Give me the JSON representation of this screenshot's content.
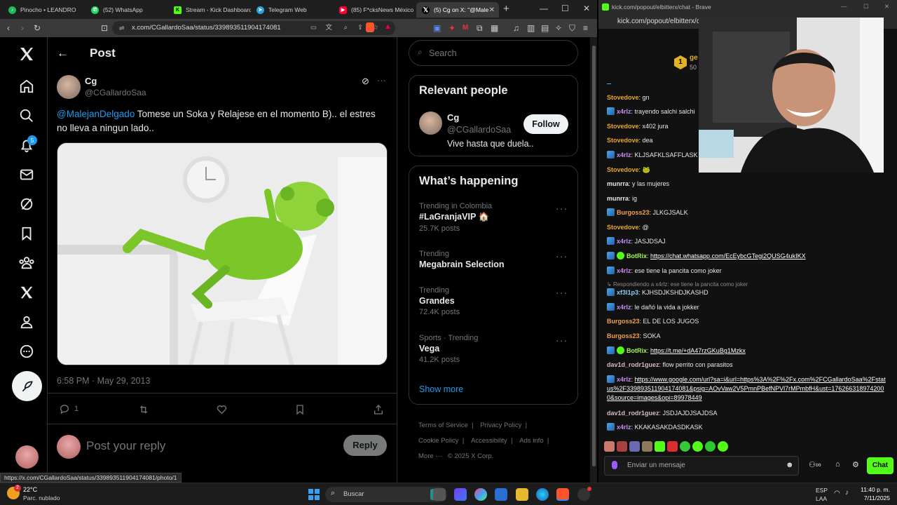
{
  "left_browser": {
    "tabs": [
      {
        "label": "Pinocho • LEANDRO",
        "color": "#1db954"
      },
      {
        "label": "(52) WhatsApp",
        "color": "#25d366"
      },
      {
        "label": "Stream - Kick Dashboard",
        "color": "#53fc18"
      },
      {
        "label": "Telegram Web",
        "color": "#2aa3e0"
      },
      {
        "label": "(85) F*cksNews México",
        "color": "#ff0033"
      },
      {
        "label": "(5) Cg on X: \"@Male",
        "color": "#ffffff"
      }
    ],
    "new_tab": "+",
    "window_controls": {
      "minimize": "—",
      "maximize": "☐",
      "close": "✕"
    },
    "url": "x.com/CGallardoSaa/status/339893511904174081",
    "status_bar_url": "https://x.com/CGallardoSaa/status/339893511904174081/photo/1"
  },
  "x": {
    "header_title": "Post",
    "notifications_badge": "5",
    "tweet": {
      "display_name": "Cg",
      "handle": "@CGallardoSaa",
      "mention": "@MalejanDelgado",
      "text": " Tomese un Soka y Relajese en el momento B).. el estres no lleva a ningun lado..",
      "timestamp": "6:58 PM · May 29, 2013",
      "reply_count": "1"
    },
    "reply_placeholder": "Post your reply",
    "reply_button": "Reply",
    "search_placeholder": "Search",
    "relevant_people": {
      "title": "Relevant people",
      "name": "Cg",
      "handle": "@CGallardoSaa",
      "bio": "Vive hasta que duela..",
      "follow_label": "Follow"
    },
    "whats_happening": {
      "title": "What’s happening",
      "trends": [
        {
          "meta": "Trending in Colombia",
          "name": "#LaGranjaVIP 🏠",
          "posts": "25.7K posts"
        },
        {
          "meta": "Trending",
          "name": "Megabrain Selection",
          "posts": ""
        },
        {
          "meta": "Trending",
          "name": "Grandes",
          "posts": "72.4K posts"
        },
        {
          "meta": "Sports · Trending",
          "name": "Vega",
          "posts": "41.2K posts"
        }
      ],
      "show_more": "Show more"
    },
    "footer": {
      "terms": "Terms of Service",
      "privacy": "Privacy Policy",
      "cookie": "Cookie Policy",
      "accessibility": "Accessibility",
      "ads": "Ads info",
      "more": "More ···",
      "copyright": "© 2025 X Corp."
    }
  },
  "right_browser": {
    "title": "kick.com/popout/elbitterx/chat - Brave",
    "url": "kick.com/popout/elbitterx/c",
    "chat_header_rank": "1",
    "chat_header_name": "ge",
    "chat_header_count": "50",
    "messages": [
      {
        "user": "Stovedove",
        "color": "#e6a82a",
        "badge": "",
        "text": "gn"
      },
      {
        "user": "x4rlz",
        "color": "#c58cf0",
        "badge": "blue",
        "text": "trayendo salchi salchi"
      },
      {
        "user": "Stovedove",
        "color": "#e6a82a",
        "badge": "",
        "text": "x402 jura"
      },
      {
        "user": "Stovedove",
        "color": "#e6a82a",
        "badge": "",
        "text": "dea"
      },
      {
        "user": "x4rlz",
        "color": "#c58cf0",
        "badge": "blue",
        "text": "KLJSAFKLSAFFLASK"
      },
      {
        "user": "Stovedove",
        "color": "#e6a82a",
        "badge": "",
        "text": "🐸"
      },
      {
        "user": "munrra",
        "color": "#e8e8e8",
        "badge": "",
        "text": "y las mujeres"
      },
      {
        "user": "munrra",
        "color": "#e8e8e8",
        "badge": "",
        "text": "ig"
      },
      {
        "user": "Burgoss23",
        "color": "#f0a050",
        "badge": "blue",
        "text": "JLKGJSALK"
      },
      {
        "user": "Stovedove",
        "color": "#e6a82a",
        "badge": "",
        "text": "@"
      },
      {
        "user": "x4rlz",
        "color": "#c58cf0",
        "badge": "blue",
        "text": "JASJDSAJ"
      },
      {
        "user": "BotRix",
        "color": "#a4f54c",
        "badge": "bot",
        "text": "https://chat.whatsapp.com/EcEybcGTegi2QUSG4ukIKX",
        "link": true
      },
      {
        "user": "x4rlz",
        "color": "#c58cf0",
        "badge": "blue",
        "text": "ese tiene la pancita como joker"
      },
      {
        "user": "xf3l1p3",
        "color": "#8ad0f8",
        "badge": "blue",
        "text": "KJHSDJKSHDJKASHD",
        "reply": "Respondiendo a x4rlz: ese tiene la pancita como joker"
      },
      {
        "user": "x4rlz",
        "color": "#c58cf0",
        "badge": "blue",
        "text": "le dañó la vida a jokker"
      },
      {
        "user": "Burgoss23",
        "color": "#f0a050",
        "badge": "",
        "text": "EL DE LOS JUGOS"
      },
      {
        "user": "Burgoss23",
        "color": "#f0a050",
        "badge": "",
        "text": "SOKA"
      },
      {
        "user": "BotRix",
        "color": "#a4f54c",
        "badge": "bot",
        "text": "https://t.me/+dA47rzGKuBg1Mzkx",
        "link": true
      },
      {
        "user": "dav1d_rodr1guez",
        "color": "#d8b8c8",
        "badge": "",
        "text": "flow perrito con parasitos"
      },
      {
        "user": "x4rlz",
        "color": "#c58cf0",
        "badge": "blue",
        "text": "https://www.google.com/url?sa=i&url=https%3A%2F%2Fx.com%2FCGallardoSaa%2Fstatus%2F339893511904174081&psig=AOvVaw2V5PmnPBefNPVl7rMPmbfH&ust=1762663189742000&source=images&opi=89978449",
        "link": true
      },
      {
        "user": "dav1d_rodr1guez",
        "color": "#d8b8c8",
        "badge": "",
        "text": "JSDJAJDJSAJDSA"
      },
      {
        "user": "x4rlz",
        "color": "#c58cf0",
        "badge": "blue",
        "text": "KKAKASAKDASDKASK"
      }
    ],
    "input_placeholder": "Enviar un mensaje",
    "chat_button": "Chat"
  },
  "taskbar": {
    "weather_temp": "22°C",
    "weather_desc": "Parc. nublado",
    "weather_alert": "2",
    "search_placeholder": "Buscar",
    "lang": "ESP",
    "lang2": "LAA",
    "time": "11:40 p. m.",
    "date": "7/11/2025"
  }
}
